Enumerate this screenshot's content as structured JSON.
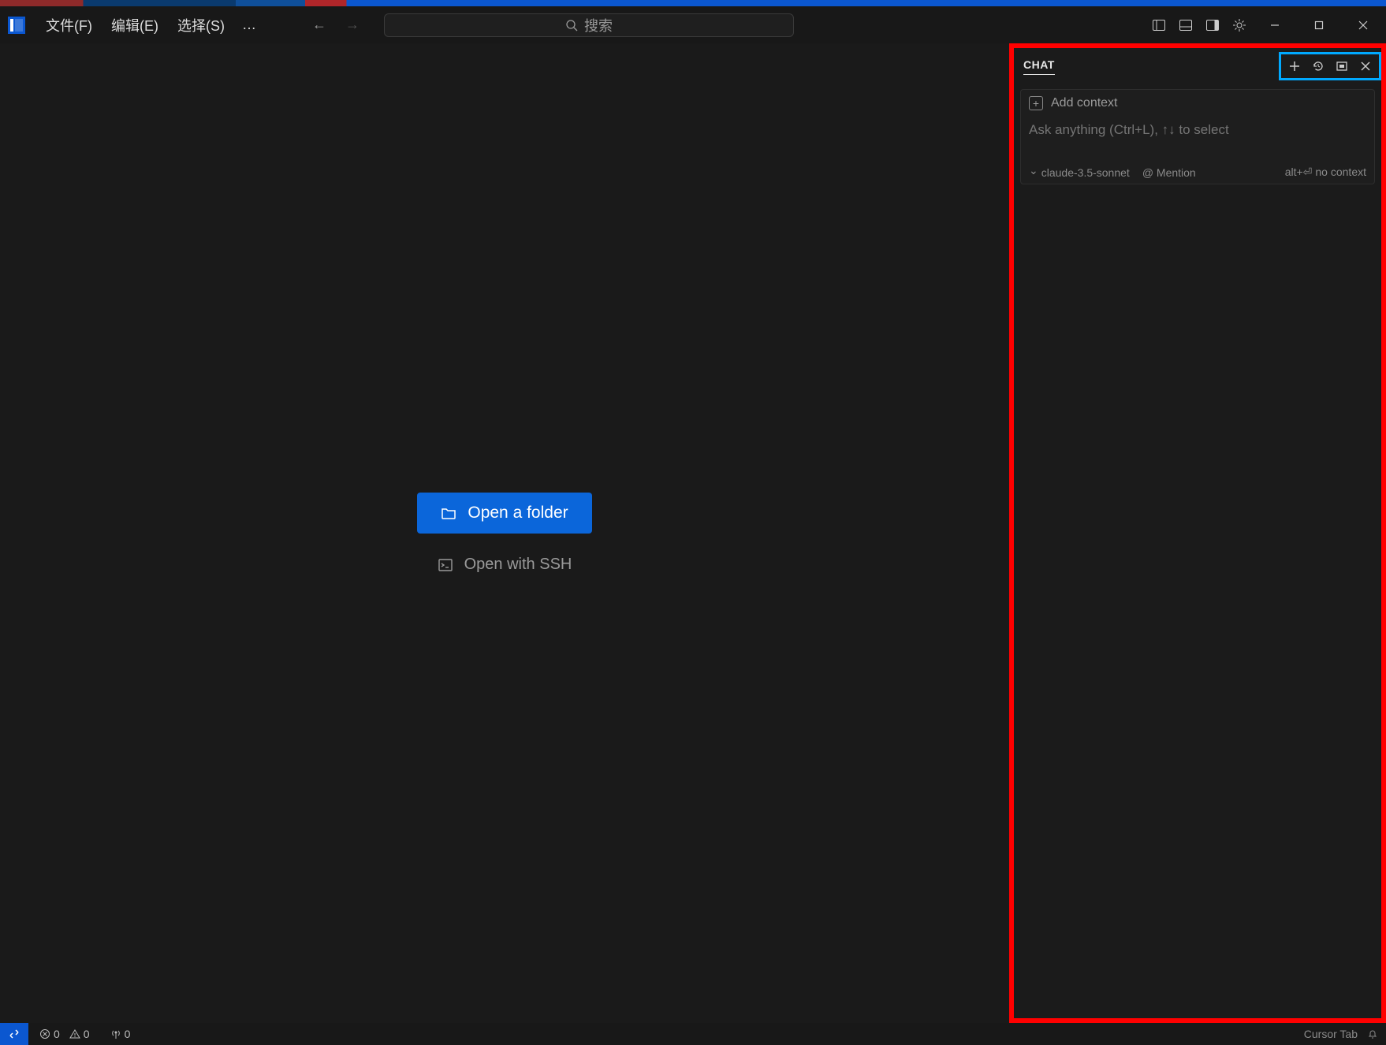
{
  "menus": {
    "file": "文件(F)",
    "edit": "编辑(E)",
    "select": "选择(S)"
  },
  "search": {
    "placeholder": "搜索"
  },
  "editor": {
    "open_folder": "Open a folder",
    "open_ssh": "Open with SSH"
  },
  "chat": {
    "tab": "CHAT",
    "add_context": "Add context",
    "input_placeholder": "Ask anything (Ctrl+L), ↑↓ to select",
    "model": "claude-3.5-sonnet",
    "mention": "@ Mention",
    "no_context_key": "alt+⏎",
    "no_context_text": "no context"
  },
  "statusbar": {
    "errors": "0",
    "warnings": "0",
    "ports": "0",
    "cursor_tab": "Cursor Tab"
  }
}
